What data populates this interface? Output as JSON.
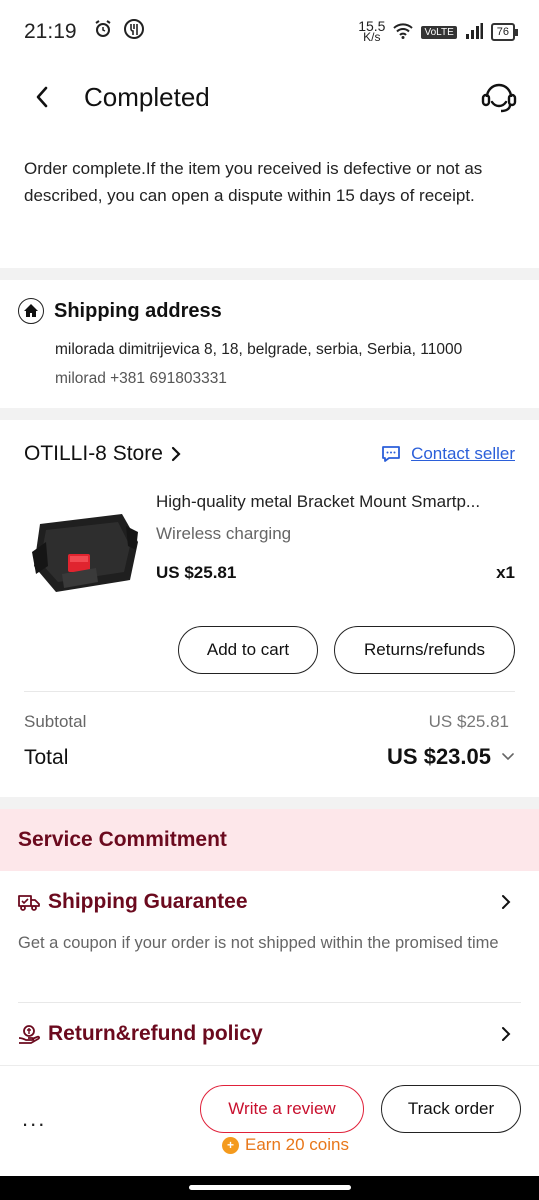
{
  "status_bar": {
    "time": "21:19",
    "speed_value": "15.5",
    "speed_unit": "K/s",
    "network_label": "VoLTE",
    "battery": "76"
  },
  "header": {
    "title": "Completed",
    "back_icon": "chevron-left-icon",
    "support_icon": "headset-icon"
  },
  "notice": "Order complete.If the item you received is defective or not as described, you can open a dispute within 15 days of receipt.",
  "address": {
    "title": "Shipping address",
    "line1": "milorada dimitrijevica 8, 18, belgrade, serbia, Serbia, 11000",
    "line2": "milorad +381 691803331"
  },
  "store": {
    "name": "OTILLI-8 Store",
    "contact_label": "Contact seller"
  },
  "product": {
    "title": "High-quality metal Bracket Mount Smartp...",
    "variant": "Wireless charging",
    "price": "US $25.81",
    "qty": "x1"
  },
  "actions": {
    "add_to_cart": "Add to cart",
    "returns": "Returns/refunds"
  },
  "summary": {
    "subtotal_label": "Subtotal",
    "subtotal_value": "US $25.81",
    "total_label": "Total",
    "total_value": "US $23.05"
  },
  "service": {
    "title": "Service Commitment",
    "guarantee_title": "Shipping Guarantee",
    "guarantee_desc": "Get a coupon if your order is not shipped within the promised time",
    "policy_title": "Return&refund policy"
  },
  "bottom": {
    "more": "...",
    "review": "Write a review",
    "track": "Track order",
    "coins": "Earn 20 coins"
  },
  "colors": {
    "accent_red": "#c8102e",
    "maroon": "#6b0a1e",
    "link_blue": "#2b5fd9",
    "coin_orange": "#e8771a",
    "commit_bg": "#fde7ea"
  }
}
